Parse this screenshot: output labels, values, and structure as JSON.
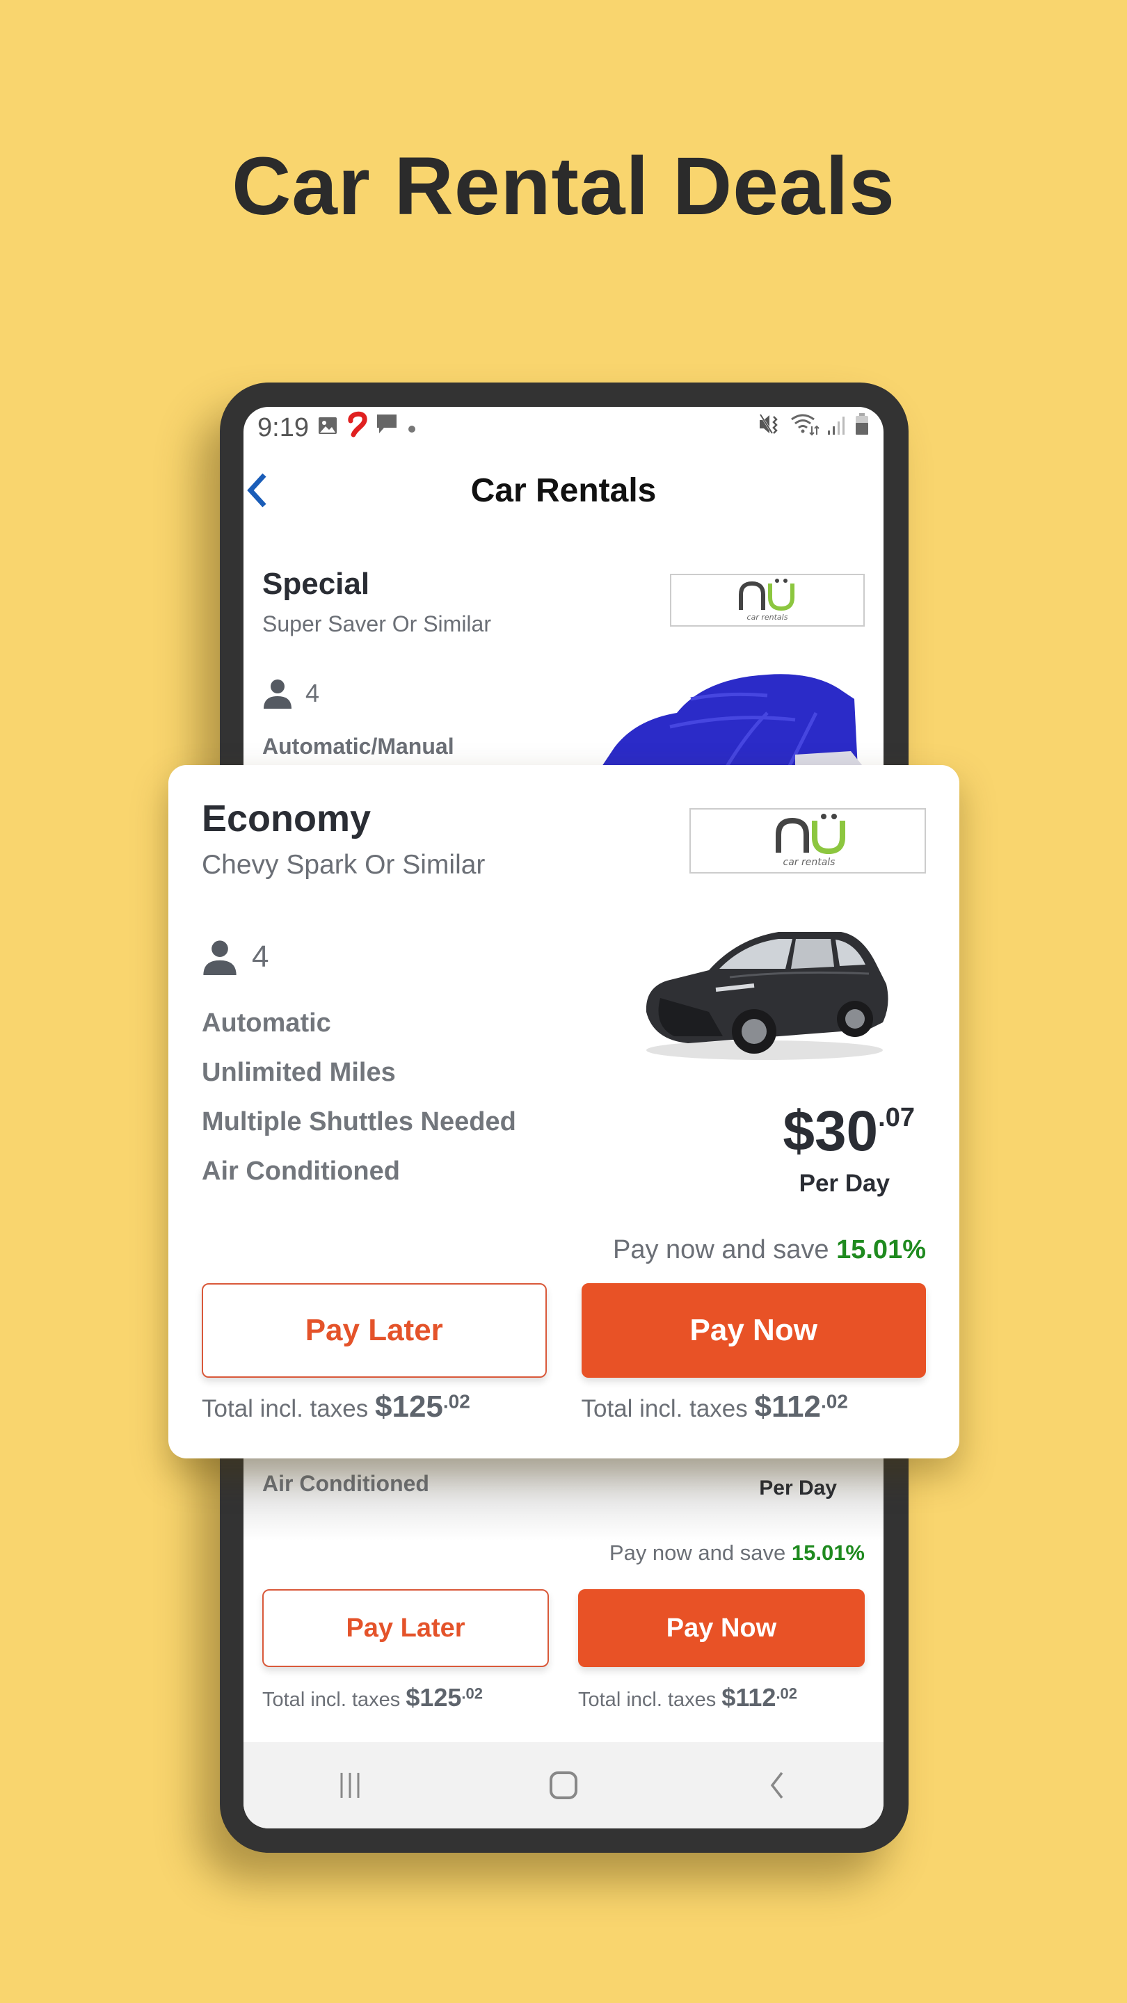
{
  "headline": "Car Rental Deals",
  "colors": {
    "background": "#F9D56E",
    "accent_orange": "#E85226",
    "save_green": "#1F8A1F",
    "back_blue": "#1A5DB8",
    "logo_green": "#8CC63F"
  },
  "status_bar": {
    "time": "9:19",
    "left_icons": [
      "gallery-icon",
      "carrier-logo-icon",
      "message-icon",
      "dot-icon"
    ],
    "right_icons": [
      "mute-vibrate-icon",
      "wifi-icon",
      "signal-icon",
      "battery-icon"
    ]
  },
  "app_bar": {
    "title": "Car Rentals",
    "back_icon": "chevron-left-icon"
  },
  "background_card_top": {
    "class_name": "Special",
    "model": "Super Saver Or Similar",
    "seats": "4",
    "feature_partial": "Automatic/Manual",
    "vendor_logo": {
      "brand": "nü",
      "tagline": "car rentals"
    }
  },
  "featured_card": {
    "class_name": "Economy",
    "model": "Chevy Spark Or Similar",
    "vendor_logo": {
      "brand": "nü",
      "tagline": "car rentals"
    },
    "seats": "4",
    "features": [
      "Automatic",
      "Unlimited Miles",
      "Multiple Shuttles Needed",
      "Air Conditioned"
    ],
    "price": {
      "whole": "$30",
      "cents": ".07",
      "unit": "Per Day"
    },
    "save": {
      "text": "Pay now and save",
      "percent": "15.01%"
    },
    "pay_later": {
      "label": "Pay Later",
      "total_label": "Total incl. taxes",
      "total_whole": "$125",
      "total_cents": ".02"
    },
    "pay_now": {
      "label": "Pay Now",
      "total_label": "Total incl. taxes",
      "total_whole": "$112",
      "total_cents": ".02"
    }
  },
  "background_card_bottom": {
    "feature_visible": "Air Conditioned",
    "price_unit": "Per Day",
    "save": {
      "text": "Pay now and save",
      "percent": "15.01%"
    },
    "pay_later": {
      "label": "Pay Later",
      "total_label": "Total incl. taxes",
      "total_whole": "$125",
      "total_cents": ".02"
    },
    "pay_now": {
      "label": "Pay Now",
      "total_label": "Total incl. taxes",
      "total_whole": "$112",
      "total_cents": ".02"
    }
  },
  "nav_bar": {
    "buttons": [
      "recents-icon",
      "home-icon",
      "back-icon"
    ]
  }
}
